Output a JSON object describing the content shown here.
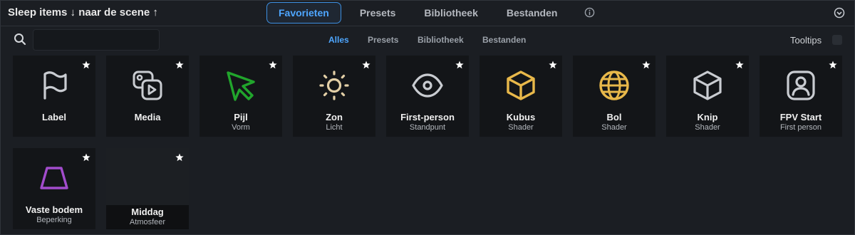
{
  "header": {
    "title": "Sleep items ↓ naar de scene ↑",
    "tabs": [
      "Favorieten",
      "Presets",
      "Bibliotheek",
      "Bestanden"
    ]
  },
  "search": {
    "value": "",
    "placeholder": ""
  },
  "filters": [
    "Alles",
    "Presets",
    "Bibliotheek",
    "Bestanden"
  ],
  "tooltips": {
    "label": "Tooltips",
    "enabled": false
  },
  "colors": {
    "accent": "#4ea6ff",
    "green": "#21a52c",
    "gold": "#e8b84a",
    "purple": "#a24ccc",
    "sun": "#e3cfa6"
  },
  "items": [
    {
      "name": "Label",
      "sub": "",
      "icon": "flag-icon"
    },
    {
      "name": "Media",
      "sub": "",
      "icon": "media-icon"
    },
    {
      "name": "Pijl",
      "sub": "Vorm",
      "icon": "arrow-cursor-icon"
    },
    {
      "name": "Zon",
      "sub": "Licht",
      "icon": "sun-icon"
    },
    {
      "name": "First-person",
      "sub": "Standpunt",
      "icon": "eye-icon"
    },
    {
      "name": "Kubus",
      "sub": "Shader",
      "icon": "cube-icon"
    },
    {
      "name": "Bol",
      "sub": "Shader",
      "icon": "globe-icon"
    },
    {
      "name": "Knip",
      "sub": "Shader",
      "icon": "cube-outline-icon"
    },
    {
      "name": "FPV Start",
      "sub": "First person",
      "icon": "person-frame-icon"
    },
    {
      "name": "Vaste bodem",
      "sub": "Beperking",
      "icon": "trapezoid-icon"
    },
    {
      "name": "Middag",
      "sub": "Atmosfeer",
      "icon": "atmosphere-preview"
    }
  ]
}
